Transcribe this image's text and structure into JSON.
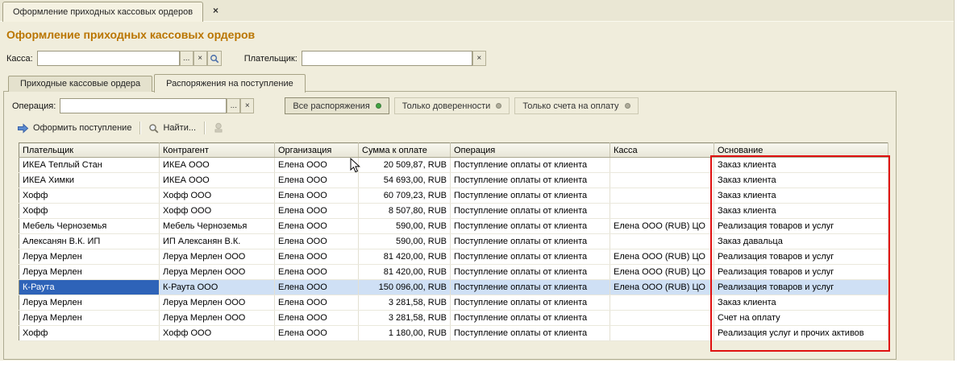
{
  "window": {
    "tab_title": "Оформление приходных кассовых ордеров",
    "close_icon": "×",
    "page_title": "Оформление приходных кассовых ордеров"
  },
  "filters": {
    "kassa_label": "Касса:",
    "kassa_value": "",
    "payer_label": "Плательщик:",
    "payer_value": "",
    "ellipsis_button": "...",
    "clear_button": "×"
  },
  "tabs": {
    "orders": "Приходные кассовые ордера",
    "dispositions": "Распоряжения на поступление"
  },
  "operation": {
    "label": "Операция:",
    "value": "",
    "ellipsis_button": "...",
    "clear_button": "×"
  },
  "segments": [
    {
      "label": "Все распоряжения",
      "active": true
    },
    {
      "label": "Только доверенности",
      "active": false
    },
    {
      "label": "Только счета на оплату",
      "active": false
    }
  ],
  "toolbar": {
    "register_label": "Оформить поступление",
    "find_label": "Найти..."
  },
  "table": {
    "columns": [
      "Плательщик",
      "Контрагент",
      "Организация",
      "Сумма к оплате",
      "Операция",
      "Касса",
      "Основание"
    ],
    "selected_index": 8,
    "rows": [
      [
        "ИКЕА Теплый Стан",
        "ИКЕА ООО",
        "Елена ООО",
        "20 509,87, RUB",
        "Поступление оплаты от клиента",
        "",
        "Заказ клиента"
      ],
      [
        "ИКЕА Химки",
        "ИКЕА ООО",
        "Елена ООО",
        "54 693,00, RUB",
        "Поступление оплаты от клиента",
        "",
        "Заказ клиента"
      ],
      [
        "Хофф",
        "Хофф ООО",
        "Елена ООО",
        "60 709,23, RUB",
        "Поступление оплаты от клиента",
        "",
        "Заказ клиента"
      ],
      [
        "Хофф",
        "Хофф ООО",
        "Елена ООО",
        "8 507,80, RUB",
        "Поступление оплаты от клиента",
        "",
        "Заказ клиента"
      ],
      [
        "Мебель Черноземья",
        "Мебель Черноземья",
        "Елена ООО",
        "590,00, RUB",
        "Поступление оплаты от клиента",
        "Елена ООО (RUB) ЦО",
        "Реализация товаров и услуг"
      ],
      [
        "Алексанян В.К. ИП",
        "ИП Алексанян В.К.",
        "Елена ООО",
        "590,00, RUB",
        "Поступление оплаты от клиента",
        "",
        "Заказ давальца"
      ],
      [
        "Леруа Мерлен",
        "Леруа Мерлен ООО",
        "Елена ООО",
        "81 420,00, RUB",
        "Поступление оплаты от клиента",
        "Елена ООО (RUB) ЦО",
        "Реализация товаров и услуг"
      ],
      [
        "Леруа Мерлен",
        "Леруа Мерлен ООО",
        "Елена ООО",
        "81 420,00, RUB",
        "Поступление оплаты от клиента",
        "Елена ООО (RUB) ЦО",
        "Реализация товаров и услуг"
      ],
      [
        "К-Раута",
        "К-Раута ООО",
        "Елена ООО",
        "150 096,00, RUB",
        "Поступление оплаты от клиента",
        "Елена ООО (RUB) ЦО",
        "Реализация товаров и услуг"
      ],
      [
        "Леруа Мерлен",
        "Леруа Мерлен ООО",
        "Елена ООО",
        "3 281,58, RUB",
        "Поступление оплаты от клиента",
        "",
        "Заказ клиента"
      ],
      [
        "Леруа Мерлен",
        "Леруа Мерлен ООО",
        "Елена ООО",
        "3 281,58, RUB",
        "Поступление оплаты от клиента",
        "",
        "Счет на оплату"
      ],
      [
        "Хофф",
        "Хофф ООО",
        "Елена ООО",
        "1 180,00, RUB",
        "Поступление оплаты от клиента",
        "",
        "Реализация услуг и прочих активов"
      ]
    ]
  },
  "colors": {
    "title_color": "#BA7500",
    "selection_cell": "#2E63B8",
    "selection_row": "#CFE0F5",
    "annotation_red": "#E01010",
    "dot_active": "#3FA33F",
    "dot_inactive": "#AFAC9A"
  }
}
